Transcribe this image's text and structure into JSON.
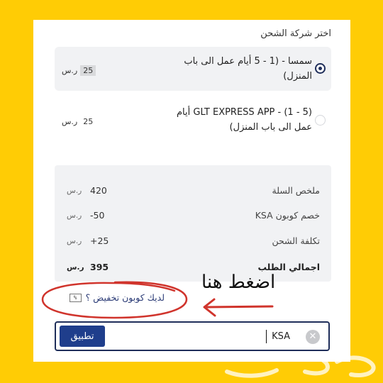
{
  "shipping": {
    "heading": "اختر شركة الشحن",
    "options": [
      {
        "label": "سمسا - (1 - 5 أيام عمل الى باب المنزل)",
        "price": "25",
        "currency": "ر.س",
        "selected": true
      },
      {
        "label": "GLT EXPRESS APP - (1 - 5) أيام عمل الى باب المنزل)",
        "price": "25",
        "currency": "ر.س",
        "selected": false
      }
    ]
  },
  "summary": {
    "rows": [
      {
        "label": "ملخص السلة",
        "value": "420",
        "currency": "ر.س"
      },
      {
        "label": "خصم كوبون KSA",
        "value": "-50",
        "currency": "ر.س"
      },
      {
        "label": "تكلفة الشحن",
        "value": "+25",
        "currency": "ر.س"
      },
      {
        "label": "اجمالي الطلب",
        "value": "395",
        "currency": "ر.س"
      }
    ]
  },
  "coupon": {
    "link_text": "لديك كوبون تخفيض ؟",
    "icon": "coupon-icon",
    "input_value": "KSA",
    "apply_label": "تطبيق",
    "clear_icon": "close-icon"
  },
  "annotation": {
    "text": "اضغط هنا",
    "color": "#D0342C"
  },
  "colors": {
    "background": "#FFCC05",
    "primary": "#1F3E8C",
    "annotation_red": "#D0342C"
  }
}
